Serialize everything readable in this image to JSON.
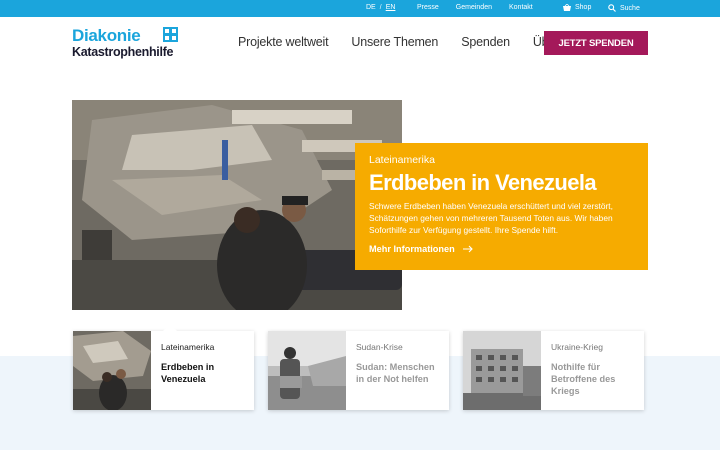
{
  "topbar": {
    "lang_de": "DE",
    "lang_sep": "/",
    "lang_en": "EN",
    "links": [
      "Presse",
      "Gemeinden",
      "Kontakt"
    ],
    "shop_label": "Shop",
    "search_label": "Suche",
    "shop_icon": "basket-icon",
    "search_icon": "search-icon"
  },
  "logo": {
    "line1": "Diakonie",
    "line2": "Katastrophenhilfe"
  },
  "nav": {
    "items": [
      "Projekte weltweit",
      "Unsere Themen",
      "Spenden",
      "Über uns"
    ],
    "cta": "JETZT SPENDEN"
  },
  "teaser": {
    "region": "Lateinamerika",
    "title": "Erdbeben in Venezuela",
    "text": "Schwere Erdbeben haben Venezuela erschüttert und viel zerstört, Schätzungen gehen von mehreren Tausend Toten aus. Wir haben Soforthilfe zur Verfügung gestellt. Ihre Spende hilft.",
    "more": "Mehr Informationen",
    "more_icon": "arrow-right-icon"
  },
  "cards": [
    {
      "category": "Lateinamerika",
      "title": "Erdbeben in Venezuela",
      "active": true
    },
    {
      "category": "Sudan-Krise",
      "title": "Sudan: Menschen in der Not helfen",
      "active": false
    },
    {
      "category": "Ukraine-Krieg",
      "title": "Nothilfe für Betroffene des Kriegs",
      "active": false
    }
  ],
  "colors": {
    "brand_blue": "#1ba5dc",
    "cta_magenta": "#a4195a",
    "teaser_orange": "#f6ab00"
  }
}
